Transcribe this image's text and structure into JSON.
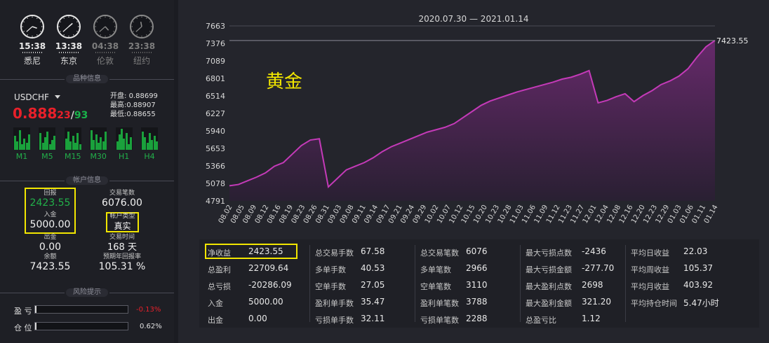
{
  "clocks": [
    {
      "time": "15:38",
      "city": "悉尼",
      "active": true,
      "h": 3,
      "m": 38
    },
    {
      "time": "13:38",
      "city": "东京",
      "active": true,
      "h": 1,
      "m": 38
    },
    {
      "time": "04:38",
      "city": "伦敦",
      "active": false,
      "h": 4,
      "m": 38
    },
    {
      "time": "23:38",
      "city": "纽约",
      "active": false,
      "h": 11,
      "m": 38
    }
  ],
  "sections": {
    "symbol_info": "品种信息",
    "account_info": "帐户信息",
    "risk": "风险提示"
  },
  "symbol": {
    "name": "USDCHF",
    "price_main": "0.888",
    "price_sup": "23",
    "price_slash": "/",
    "price_alt": "93",
    "open_label": "开盘:",
    "open": "0.88699",
    "high_label": "最高:",
    "high": "0.88907",
    "low_label": "最低:",
    "low": "0.88655"
  },
  "timeframes": [
    "M1",
    "M5",
    "M15",
    "M30",
    "H1",
    "H4"
  ],
  "account": {
    "return_label": "回报",
    "return_value": "2423.55",
    "deposit_label": "入金",
    "deposit_value": "5000.00",
    "trades_label": "交易笔数",
    "trades_value": "6076.00",
    "type_label": "帐户类型",
    "type_value": "真实",
    "withdraw_label": "出金",
    "withdraw_value": "0.00",
    "time_label": "交易时间",
    "time_value": "168 天",
    "balance_label": "余额",
    "balance_value": "7423.55",
    "annual_label": "预期年回报率",
    "annual_value": "105.31 %"
  },
  "risk": {
    "pnl_label": "盈 亏",
    "pnl_value": "-0.13%",
    "pnl_fraction": 0.0013,
    "pos_label": "仓 位",
    "pos_value": "0.62%",
    "pos_fraction": 0.0062
  },
  "colors": {
    "accent_yellow": "#f2e600",
    "up_green": "#22b04a",
    "down_red": "#e8202a",
    "line_magenta": "#c43ab8"
  },
  "chart_data": {
    "type": "area",
    "title": "2020.07.30 — 2021.01.14",
    "overlay_label": "黄金",
    "last_value_label": "7423.55",
    "y_ticks": [
      4791,
      5078,
      5366,
      5653,
      5940,
      6227,
      6514,
      6801,
      7089,
      7376,
      7663
    ],
    "ylim": [
      4791,
      7663
    ],
    "x_ticks": [
      "08.02",
      "08.05",
      "08.09",
      "08.12",
      "08.16",
      "08.19",
      "08.23",
      "08.26",
      "08.31",
      "09.03",
      "09.08",
      "09.11",
      "09.14",
      "09.17",
      "09.21",
      "09.24",
      "09.29",
      "10.02",
      "10.07",
      "10.12",
      "10.15",
      "10.20",
      "10.23",
      "10.28",
      "11.03",
      "11.06",
      "11.09",
      "11.12",
      "11.23",
      "11.27",
      "12.01",
      "12.04",
      "12.08",
      "12.16",
      "12.20",
      "12.23",
      "12.29",
      "01.03",
      "01.06",
      "01.11",
      "01.14"
    ],
    "series": [
      {
        "values": [
          5040,
          5060,
          5120,
          5180,
          5250,
          5360,
          5420,
          5560,
          5700,
          5790,
          5810,
          5020,
          5160,
          5300,
          5360,
          5420,
          5500,
          5600,
          5680,
          5740,
          5800,
          5860,
          5920,
          5960,
          6000,
          6060,
          6160,
          6260,
          6360,
          6430,
          6480,
          6530,
          6580,
          6620,
          6660,
          6700,
          6740,
          6790,
          6820,
          6870,
          6930,
          6400,
          6440,
          6500,
          6550,
          6420,
          6520,
          6600,
          6700,
          6760,
          6840,
          6960,
          7150,
          7320,
          7423.55
        ]
      }
    ]
  },
  "stats": {
    "col1": [
      {
        "label": "净收益",
        "value": "2423.55"
      },
      {
        "label": "总盈利",
        "value": "22709.64"
      },
      {
        "label": "总亏损",
        "value": "-20286.09"
      },
      {
        "label": "入金",
        "value": "5000.00"
      },
      {
        "label": "出金",
        "value": "0.00"
      }
    ],
    "col2": [
      {
        "label": "总交易手数",
        "value": "67.58"
      },
      {
        "label": "多单手数",
        "value": "40.53"
      },
      {
        "label": "空单手数",
        "value": "27.05"
      },
      {
        "label": "盈利单手数",
        "value": "35.47"
      },
      {
        "label": "亏损单手数",
        "value": "32.11"
      }
    ],
    "col3": [
      {
        "label": "总交易笔数",
        "value": "6076"
      },
      {
        "label": "多单笔数",
        "value": "2966"
      },
      {
        "label": "空单笔数",
        "value": "3110"
      },
      {
        "label": "盈利单笔数",
        "value": "3788"
      },
      {
        "label": "亏损单笔数",
        "value": "2288"
      }
    ],
    "col4": [
      {
        "label": "最大亏损点数",
        "value": "-2436"
      },
      {
        "label": "最大亏损金额",
        "value": "-277.70"
      },
      {
        "label": "最大盈利点数",
        "value": "2698"
      },
      {
        "label": "最大盈利金额",
        "value": "321.20"
      },
      {
        "label": "总盈亏比",
        "value": "1.12"
      }
    ],
    "col5": [
      {
        "label": "平均日收益",
        "value": "22.03"
      },
      {
        "label": "平均周收益",
        "value": "105.37"
      },
      {
        "label": "平均月收益",
        "value": "403.92"
      },
      {
        "label": "平均持仓时间",
        "value": "5.47小时"
      }
    ]
  }
}
